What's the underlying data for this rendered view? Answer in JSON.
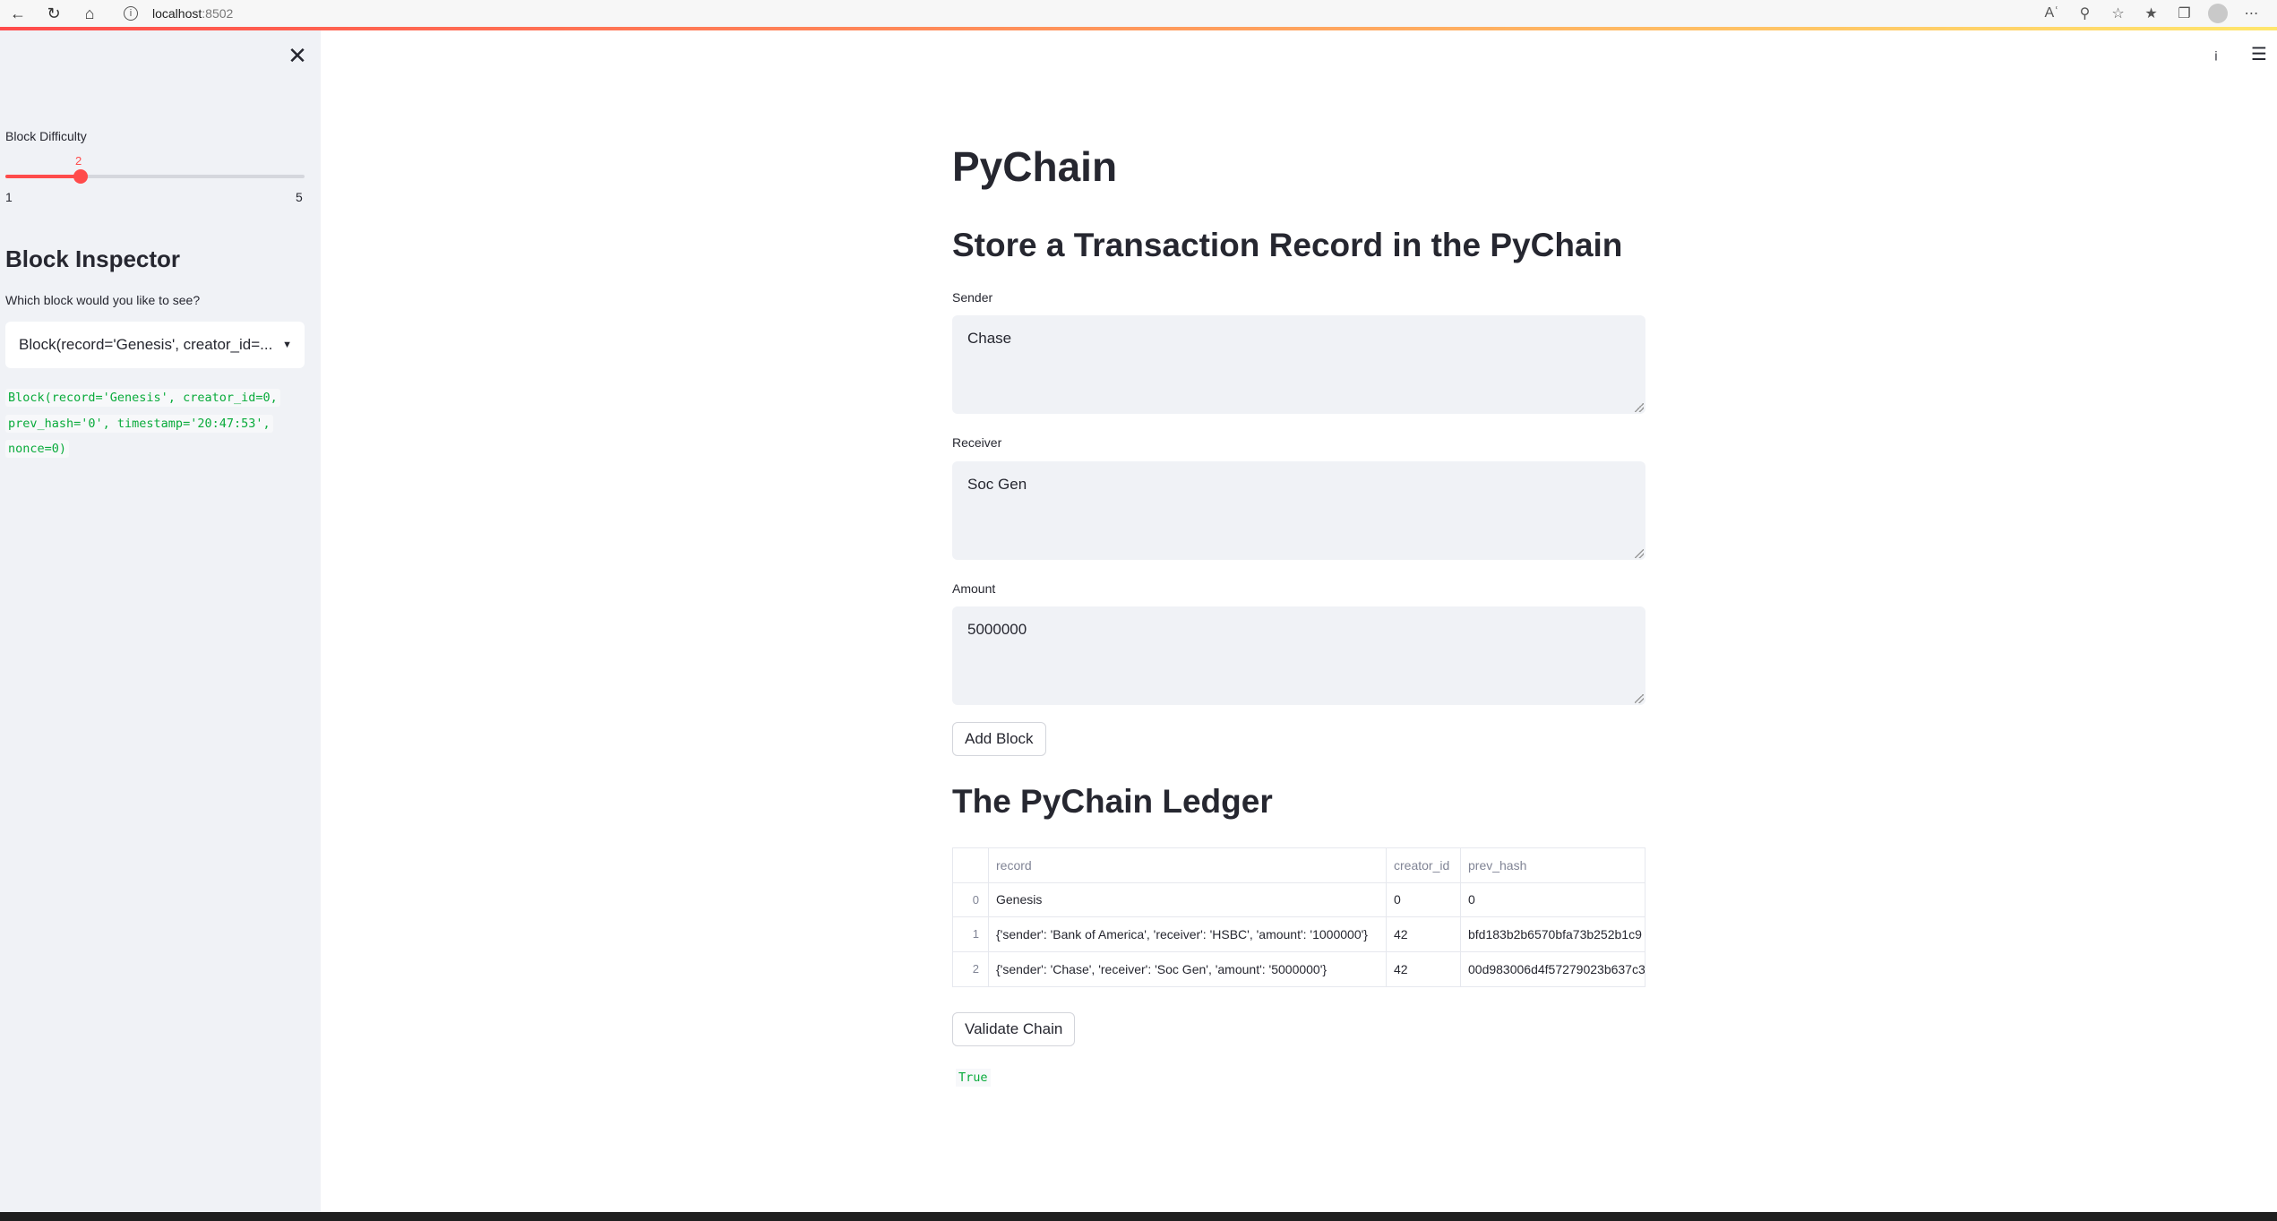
{
  "browser": {
    "url_host": "localhost",
    "url_port": ":8502",
    "icons": [
      "back-icon",
      "reload-icon",
      "home-icon",
      "info-icon",
      "read-aloud-icon",
      "zoom-icon",
      "favorite-add-icon",
      "favorites-icon",
      "collections-icon",
      "profile-icon",
      "more-icon"
    ]
  },
  "sidebar": {
    "close_icon": "✕",
    "slider": {
      "label": "Block Difficulty",
      "value": "2",
      "min": "1",
      "max": "5",
      "fraction": 0.25,
      "accent_color": "#ff4b4b"
    },
    "inspector_header": "Block Inspector",
    "select_label": "Which block would you like to see?",
    "select_value": "Block(record='Genesis', creator_id=...",
    "code_lines": [
      "Block(record='Genesis', creator_id=0,",
      "prev_hash='0', timestamp='20:47:53',",
      "nonce=0)"
    ]
  },
  "main": {
    "title": "PyChain",
    "subheader": "Store a Transaction Record in the PyChain",
    "sender_label": "Sender",
    "sender_value": "Chase",
    "receiver_label": "Receiver",
    "receiver_value": "Soc Gen",
    "amount_label": "Amount",
    "amount_value": "5000000",
    "add_block_button": "Add Block",
    "ledger_header": "The PyChain Ledger",
    "table": {
      "columns": [
        "",
        "record",
        "creator_id",
        "prev_hash"
      ],
      "rows": [
        [
          "0",
          "Genesis",
          "0",
          "0"
        ],
        [
          "1",
          "{'sender': 'Bank of America', 'receiver': 'HSBC', 'amount': '1000000'}",
          "42",
          "bfd183b2b6570bfa73b252b1c9"
        ],
        [
          "2",
          "{'sender': 'Chase', 'receiver': 'Soc Gen', 'amount': '5000000'}",
          "42",
          "00d983006d4f57279023b637c3"
        ]
      ]
    },
    "validate_button": "Validate Chain",
    "validate_result": "True"
  },
  "app_menu": {
    "icons": [
      "info-icon",
      "hamburger-menu-icon"
    ]
  }
}
